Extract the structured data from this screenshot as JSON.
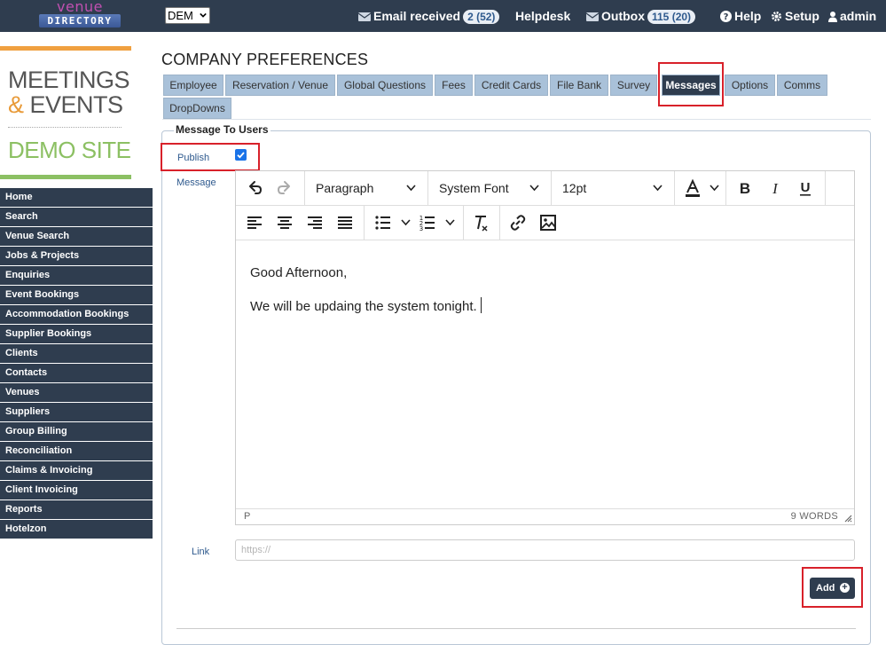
{
  "header": {
    "logo_top": "venue",
    "logo_bottom": "DIRECTORY",
    "site_select_value": "DEM",
    "email_label": "Email received",
    "email_count": "2 (52)",
    "helpdesk_label": "Helpdesk",
    "outbox_label": "Outbox",
    "outbox_count": "115 (20)",
    "help_label": "Help",
    "setup_label": "Setup",
    "user_label": "admin"
  },
  "brand": {
    "line1": "MEETINGS",
    "amp": "&",
    "line2": "EVENTS",
    "site": "DEMO SITE"
  },
  "sidebar": {
    "items": [
      {
        "label": "Home"
      },
      {
        "label": "Search"
      },
      {
        "label": "Venue Search"
      },
      {
        "label": "Jobs & Projects"
      },
      {
        "label": "Enquiries"
      },
      {
        "label": "Event Bookings"
      },
      {
        "label": "Accommodation Bookings"
      },
      {
        "label": "Supplier Bookings"
      },
      {
        "label": "Clients"
      },
      {
        "label": "Contacts"
      },
      {
        "label": "Venues"
      },
      {
        "label": "Suppliers"
      },
      {
        "label": "Group Billing"
      },
      {
        "label": "Reconciliation"
      },
      {
        "label": "Claims & Invoicing"
      },
      {
        "label": "Client Invoicing"
      },
      {
        "label": "Reports"
      },
      {
        "label": "Hotelzon"
      }
    ]
  },
  "page": {
    "title": "COMPANY PREFERENCES"
  },
  "tabs": [
    {
      "label": "Employee"
    },
    {
      "label": "Reservation / Venue"
    },
    {
      "label": "Global Questions"
    },
    {
      "label": "Fees"
    },
    {
      "label": "Credit Cards"
    },
    {
      "label": "File Bank"
    },
    {
      "label": "Survey"
    },
    {
      "label": "Messages"
    },
    {
      "label": "Options"
    },
    {
      "label": "Comms"
    },
    {
      "label": "DropDowns"
    }
  ],
  "form": {
    "legend": "Message To Users",
    "publish_label": "Publish",
    "publish_checked": true,
    "message_label": "Message",
    "link_label": "Link",
    "link_placeholder": "https://",
    "add_label": "Add"
  },
  "editor": {
    "block_format": "Paragraph",
    "font_family": "System Font",
    "font_size": "12pt",
    "content_line1": "Good Afternoon,",
    "content_line2": "We will be updaing the system tonight.",
    "status_path": "P",
    "word_count": "9 WORDS"
  },
  "colors": {
    "navbar": "#2f3d4f",
    "tab": "#a9c1d9",
    "highlight": "#d8212a",
    "brand_orange": "#f0a040",
    "brand_green": "#8cc063"
  }
}
